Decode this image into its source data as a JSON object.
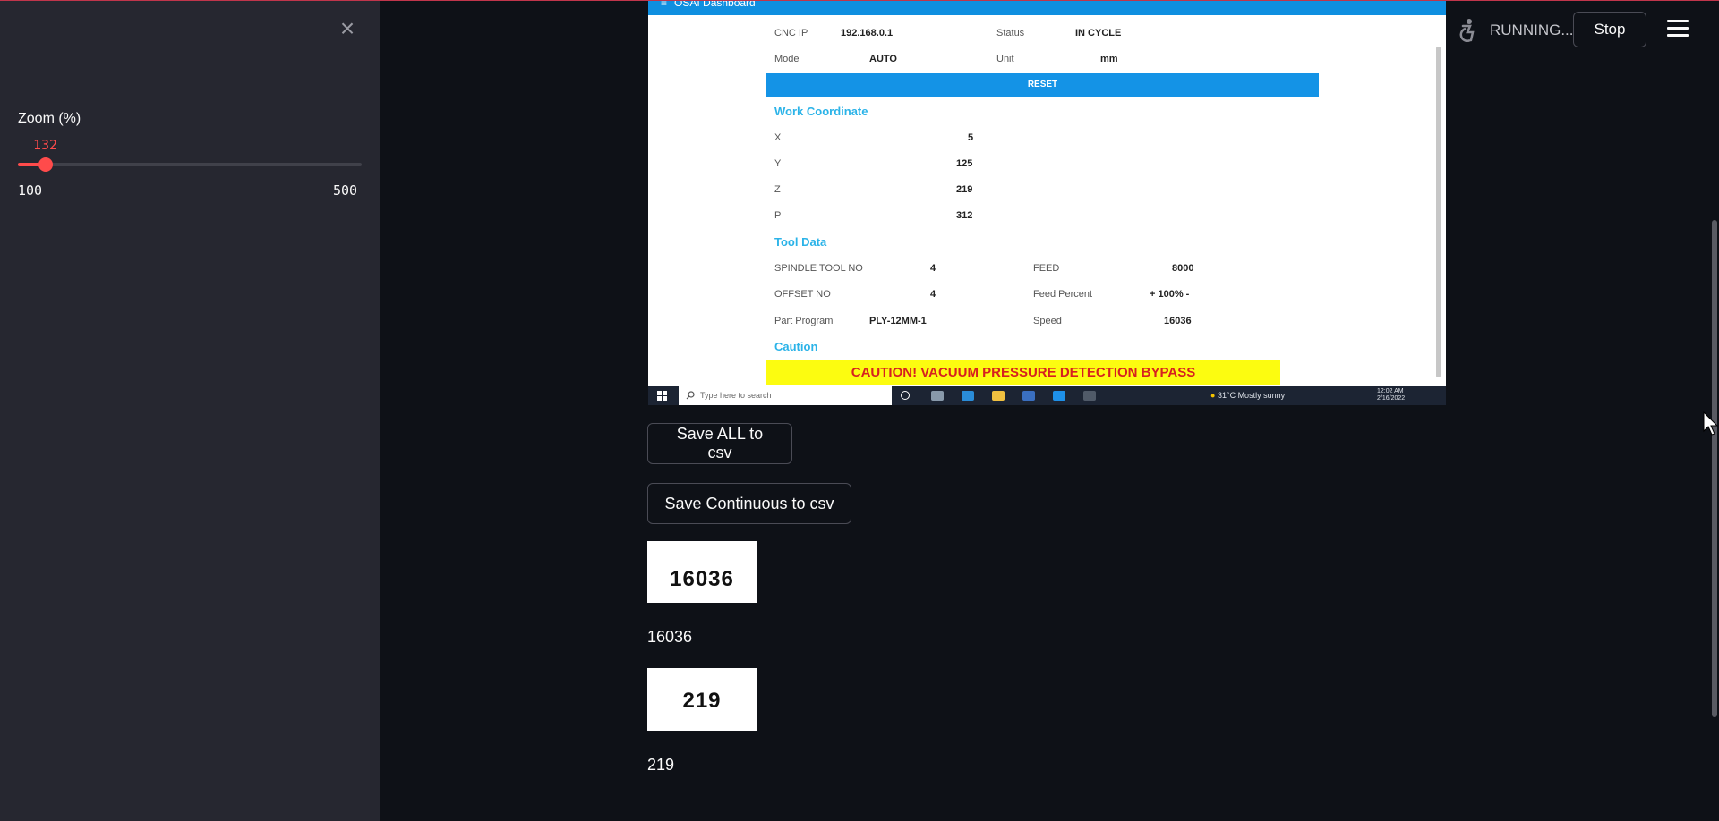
{
  "sidebar": {
    "close_label": "×",
    "zoom": {
      "label": "Zoom (%)",
      "value": "132",
      "min": "100",
      "max": "500",
      "fraction": 0.08
    }
  },
  "header": {
    "status": "RUNNING...",
    "stop_label": "Stop"
  },
  "screenshot": {
    "app_title": "OSAI Dashboard",
    "fields": {
      "cnc_ip_label": "CNC IP",
      "cnc_ip_value": "192.168.0.1",
      "status_label": "Status",
      "status_value": "IN CYCLE",
      "mode_label": "Mode",
      "mode_value": "AUTO",
      "unit_label": "Unit",
      "unit_value": "mm"
    },
    "reset_label": "RESET",
    "work_coordinate": {
      "title": "Work Coordinate",
      "rows": [
        {
          "label": "X",
          "value": "5"
        },
        {
          "label": "Y",
          "value": "125"
        },
        {
          "label": "Z",
          "value": "219"
        },
        {
          "label": "P",
          "value": "312"
        }
      ]
    },
    "tool_data": {
      "title": "Tool Data",
      "spindle_label": "SPINDLE TOOL NO",
      "spindle_value": "4",
      "feed_label": "FEED",
      "feed_value": "8000",
      "offset_label": "OFFSET NO",
      "offset_value": "4",
      "feed_percent_label": "Feed Percent",
      "feed_percent_value": "+ 100% -",
      "program_label": "Part Program",
      "program_value": "PLY-12MM-1",
      "speed_label": "Speed",
      "speed_value": "16036"
    },
    "caution": {
      "title": "Caution",
      "message": "CAUTION! VACUUM PRESSURE DETECTION BYPASS"
    },
    "taskbar": {
      "search_placeholder": "Type here to search",
      "weather": "31°C  Mostly sunny",
      "time": "12:02 AM",
      "date": "2/16/2022"
    }
  },
  "actions": {
    "save_all_label": "Save ALL to csv",
    "save_continuous_label": "Save Continuous to csv"
  },
  "results": {
    "crop1_text": "16036",
    "value1": "16036",
    "crop2_text": "219",
    "value2": "219"
  },
  "colors": {
    "accent": "#ff4b4b",
    "background": "#0e1117",
    "sidebar": "#262730",
    "dashboard_blue": "#1493e6",
    "caution_yellow": "#fcfc10"
  }
}
